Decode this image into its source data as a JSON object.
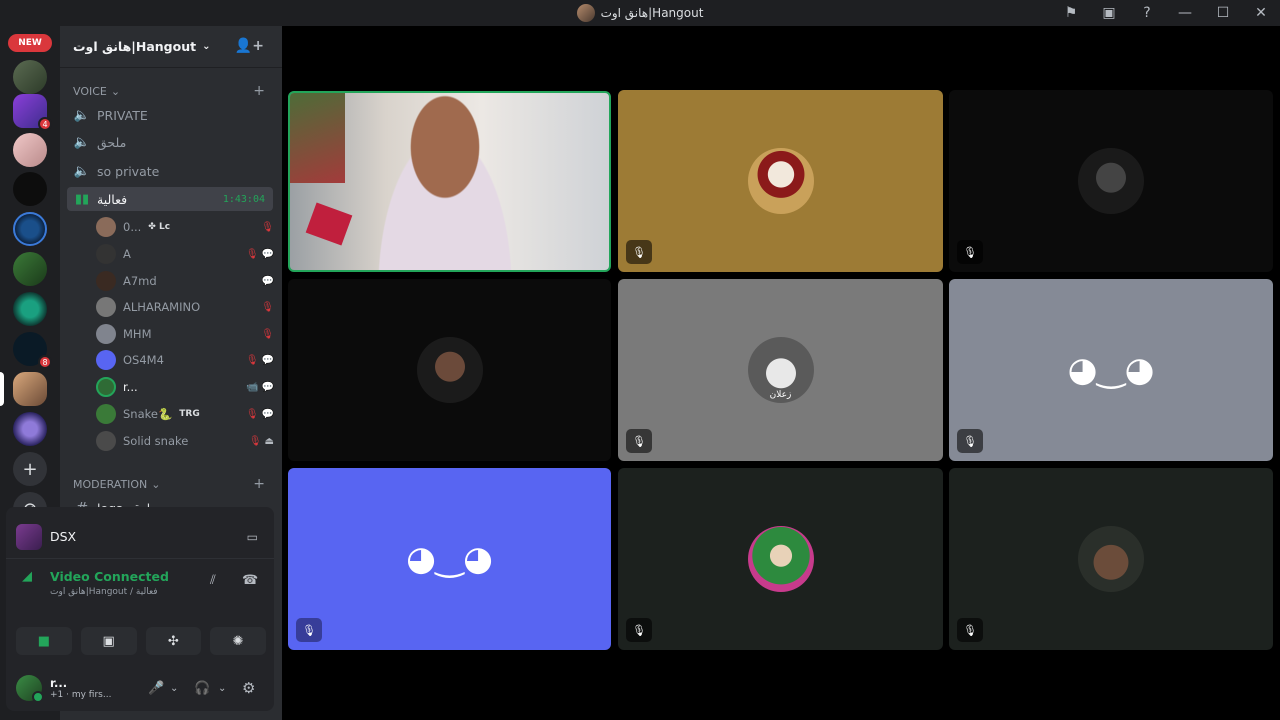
{
  "window": {
    "title": "هانق اوت|Hangout",
    "icons": [
      "flag-icon",
      "inbox-icon",
      "help-icon",
      "minimize-icon",
      "maximize-icon",
      "close-icon"
    ]
  },
  "guilds": {
    "new_label": "NEW",
    "badges": {
      "g2": "4",
      "g8": "8"
    }
  },
  "server": {
    "name": "هانق اوت|Hangout"
  },
  "categories": {
    "voice": "VOICE",
    "moderation": "MODERATION"
  },
  "channels": [
    {
      "name": "PRIVATE"
    },
    {
      "name": "ملحق"
    },
    {
      "name": "so private"
    },
    {
      "name": "فعالية",
      "timer": "1:43:04"
    }
  ],
  "members": [
    {
      "name": "0...",
      "tag": "✤ Lc"
    },
    {
      "name": "A"
    },
    {
      "name": "A7md"
    },
    {
      "name": "ALHARAMINO"
    },
    {
      "name": "MHM"
    },
    {
      "name": "OS4M4"
    },
    {
      "name": "r..."
    },
    {
      "name": "Snake🐍",
      "tag": "TRG"
    },
    {
      "name": "Solid snake"
    }
  ],
  "text_channels": [
    {
      "name": "logs-لوقز"
    }
  ],
  "activity": {
    "name": "DSX"
  },
  "voice": {
    "status": "Video Connected",
    "location": "هانق اوت|Hangout / فعالية"
  },
  "user": {
    "name": "r...",
    "status": "+1 · my firs..."
  },
  "tiles": {
    "zalan_label": "زعلان"
  },
  "colors": {
    "accent_green": "#23a55a",
    "blurple": "#5865f2",
    "danger": "#da373c"
  }
}
